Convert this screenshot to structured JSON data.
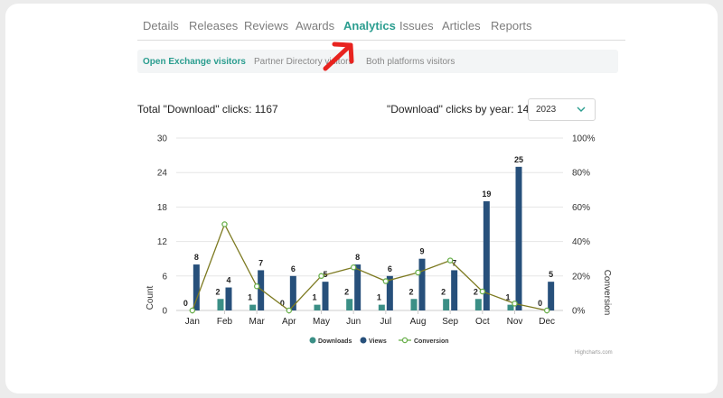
{
  "tabs": [
    {
      "label": "Details"
    },
    {
      "label": "Releases"
    },
    {
      "label": "Reviews"
    },
    {
      "label": "Awards"
    },
    {
      "label": "Analytics",
      "active": true
    },
    {
      "label": "Issues"
    },
    {
      "label": "Articles"
    },
    {
      "label": "Reports"
    }
  ],
  "subtabs": [
    {
      "label": "Open Exchange visitors",
      "active": true
    },
    {
      "label": "Partner Directory visitors"
    },
    {
      "label": "Both platforms visitors"
    }
  ],
  "summary": {
    "total_label": "Total \"Download\" clicks: 1167",
    "by_year_label": "\"Download\" clicks by year: 14",
    "year_select": "2023"
  },
  "colors": {
    "accent": "#2a9d8f",
    "downloads": "#3b8f86",
    "views": "#27507b",
    "conversion": "#7d7a21",
    "annotation_arrow": "#e8231f"
  },
  "icons": {
    "year_select": "chevron-down-icon",
    "annotation": "red-arrow"
  },
  "chart_data": {
    "type": "bar",
    "categories": [
      "Jan",
      "Feb",
      "Mar",
      "Apr",
      "May",
      "Jun",
      "Jul",
      "Aug",
      "Sep",
      "Oct",
      "Nov",
      "Dec"
    ],
    "series": [
      {
        "name": "Downloads",
        "type": "bar",
        "values": [
          0,
          2,
          1,
          0,
          1,
          2,
          1,
          2,
          2,
          2,
          1,
          0
        ]
      },
      {
        "name": "Views",
        "type": "bar",
        "values": [
          8,
          4,
          7,
          6,
          5,
          8,
          6,
          9,
          7,
          19,
          25,
          5
        ]
      },
      {
        "name": "Conversion",
        "type": "line",
        "axis": "right",
        "values": [
          0,
          50,
          14,
          0,
          20,
          25,
          17,
          22,
          29,
          11,
          4,
          0
        ]
      }
    ],
    "ylabel": "Count",
    "y2label": "Conversion",
    "ylim": [
      0,
      30
    ],
    "yticks": [
      "0",
      "6",
      "12",
      "18",
      "24",
      "30"
    ],
    "y2lim": [
      0,
      100
    ],
    "y2ticks": [
      "0%",
      "20%",
      "40%",
      "60%",
      "80%",
      "100%"
    ],
    "legend": [
      "Downloads",
      "Views",
      "Conversion"
    ],
    "legend_position": "bottom",
    "grid": true,
    "credits": "Highcharts.com"
  }
}
